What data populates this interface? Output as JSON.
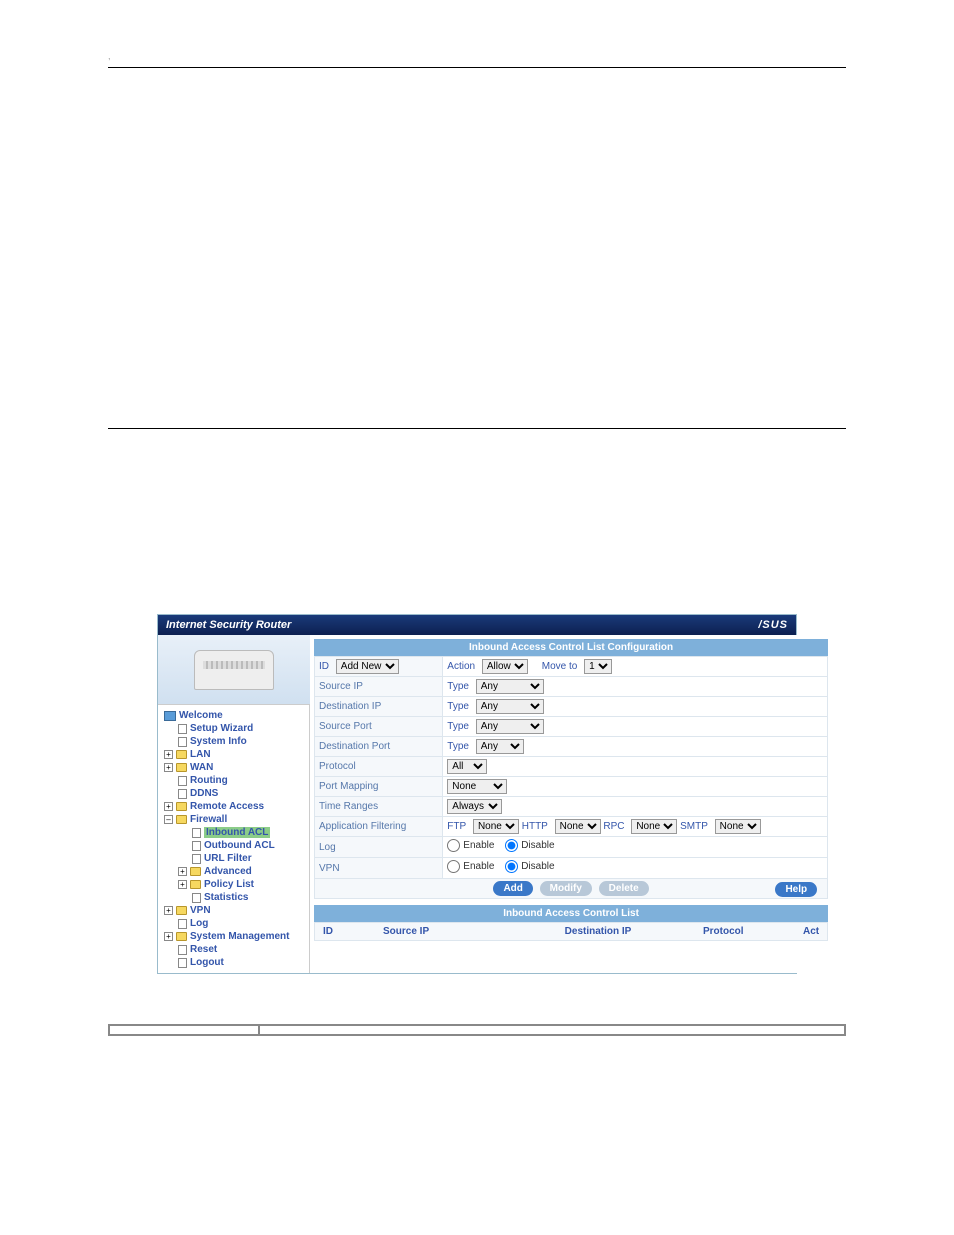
{
  "header": {
    "punctuation": ","
  },
  "router": {
    "headerTitle": "Internet Security Router",
    "logo": "/SUS"
  },
  "sidebar": {
    "welcome": "Welcome",
    "items": {
      "setupWizard": "Setup Wizard",
      "systemInfo": "System Info",
      "lan": "LAN",
      "wan": "WAN",
      "routing": "Routing",
      "ddns": "DDNS",
      "remoteAccess": "Remote Access",
      "firewall": "Firewall",
      "inboundAcl": "Inbound ACL",
      "outboundAcl": "Outbound ACL",
      "urlFilter": "URL Filter",
      "advanced": "Advanced",
      "policyList": "Policy List",
      "statistics": "Statistics",
      "vpn": "VPN",
      "log": "Log",
      "systemMgmt": "System Management",
      "reset": "Reset",
      "logout": "Logout"
    }
  },
  "panel": {
    "title": "Inbound Access Control List Configuration",
    "idLabel": "ID",
    "idValue": "Add New",
    "actionLabel": "Action",
    "actionValue": "Allow",
    "moveLabel": "Move to",
    "moveValue": "1",
    "srcIp": "Source IP",
    "dstIp": "Destination IP",
    "srcPort": "Source Port",
    "dstPort": "Destination Port",
    "protocol": "Protocol",
    "portMapping": "Port Mapping",
    "timeRanges": "Time Ranges",
    "appFiltering": "Application Filtering",
    "logLabel": "Log",
    "vpnLabel": "VPN",
    "typeLabel": "Type",
    "anyValue": "Any",
    "allValue": "All",
    "noneValue": "None",
    "alwaysValue": "Always",
    "ftpLabel": "FTP",
    "httpLabel": "HTTP",
    "rpcLabel": "RPC",
    "smtpLabel": "SMTP",
    "enable": "Enable",
    "disable": "Disable",
    "btnAdd": "Add",
    "btnModify": "Modify",
    "btnDelete": "Delete",
    "btnHelp": "Help"
  },
  "aclList": {
    "title": "Inbound Access Control List",
    "colId": "ID",
    "colSrc": "Source IP",
    "colDst": "Destination IP",
    "colProto": "Protocol",
    "colAct": "Act"
  }
}
